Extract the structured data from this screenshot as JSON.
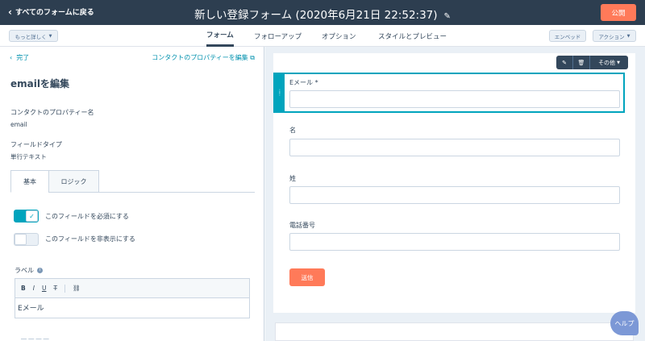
{
  "topbar": {
    "back_label": "すべてのフォームに戻る",
    "title": "新しい登録フォーム (2020年6月21日 22:52:37)",
    "publish_label": "公開"
  },
  "tabbar": {
    "more_label": "もっと詳しく",
    "tabs": [
      {
        "label": "フォーム",
        "active": true
      },
      {
        "label": "フォローアップ",
        "active": false
      },
      {
        "label": "オプション",
        "active": false
      },
      {
        "label": "スタイルとプレビュー",
        "active": false
      }
    ],
    "embed_label": "エンベッド",
    "actions_label": "アクション"
  },
  "left_panel": {
    "done_label": "完了",
    "edit_props_link": "コンタクトのプロパティーを編集",
    "edit_title": "emailを編集",
    "property_name_label": "コンタクトのプロパティー名",
    "property_name_value": "email",
    "field_type_label": "フィールドタイプ",
    "field_type_value": "単行テキスト",
    "subtabs": [
      "基本",
      "ロジック"
    ],
    "required_toggle_label": "このフィールドを必須にする",
    "required_on": true,
    "hidden_toggle_label": "このフィールドを非表示にする",
    "hidden_on": false,
    "label_heading": "ラベル",
    "rte_tools": [
      "B",
      "I",
      "U",
      "T̶",
      "⛓"
    ],
    "label_value": "Eメール"
  },
  "form": {
    "fields": [
      {
        "label": "Eメール *",
        "selected": true
      },
      {
        "label": "名",
        "selected": false
      },
      {
        "label": "姓",
        "selected": false
      },
      {
        "label": "電話番号",
        "selected": false
      }
    ],
    "more_label": "その他",
    "submit_label": "送信"
  },
  "help_label": "ヘルプ",
  "colors": {
    "topbar": "#2d3e50",
    "accent_orange": "#ff7a59",
    "accent_teal": "#00a4bd",
    "link": "#0091ae"
  }
}
